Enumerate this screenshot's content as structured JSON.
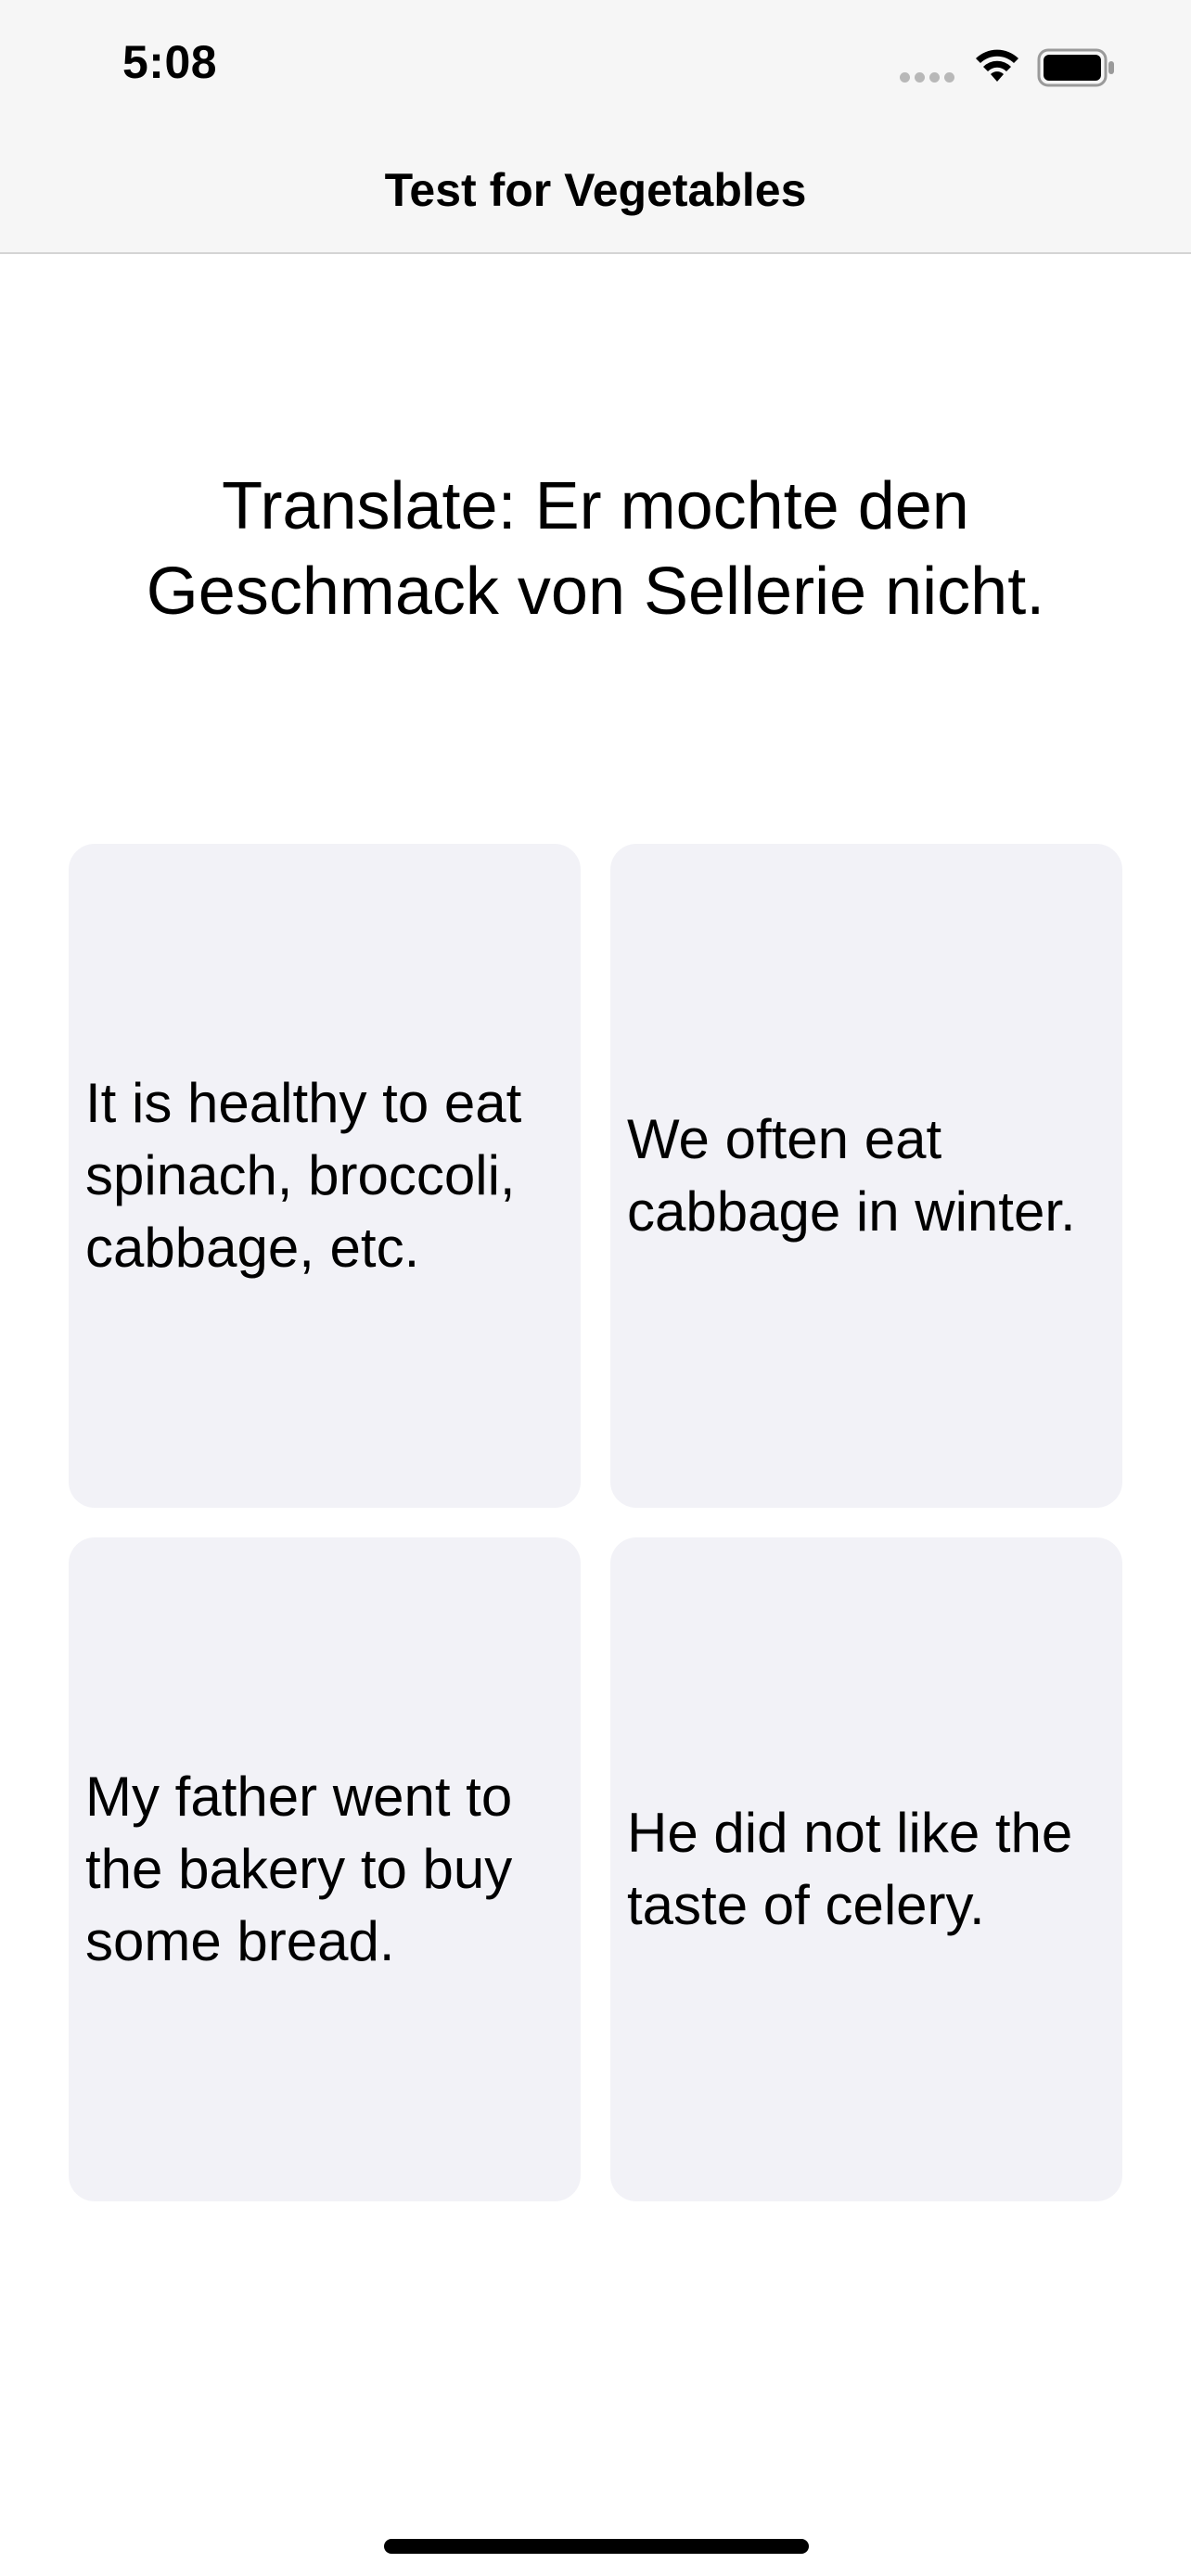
{
  "status_bar": {
    "time": "5:08",
    "icons": [
      "signal-dots-icon",
      "wifi-icon",
      "battery-icon"
    ]
  },
  "nav": {
    "title": "Test for Vegetables"
  },
  "question": {
    "prompt": "Translate: Er mochte den Geschmack von Sellerie nicht."
  },
  "options": [
    {
      "label": "It is healthy to eat spinach, broccoli, cabbage, etc."
    },
    {
      "label": "We often eat cabbage in winter."
    },
    {
      "label": "My father went to the bakery to buy some bread."
    },
    {
      "label": "He did not like the taste of celery."
    }
  ],
  "colors": {
    "card_background": "#f2f2f7",
    "bar_background": "#f6f6f6",
    "text": "#000000"
  }
}
